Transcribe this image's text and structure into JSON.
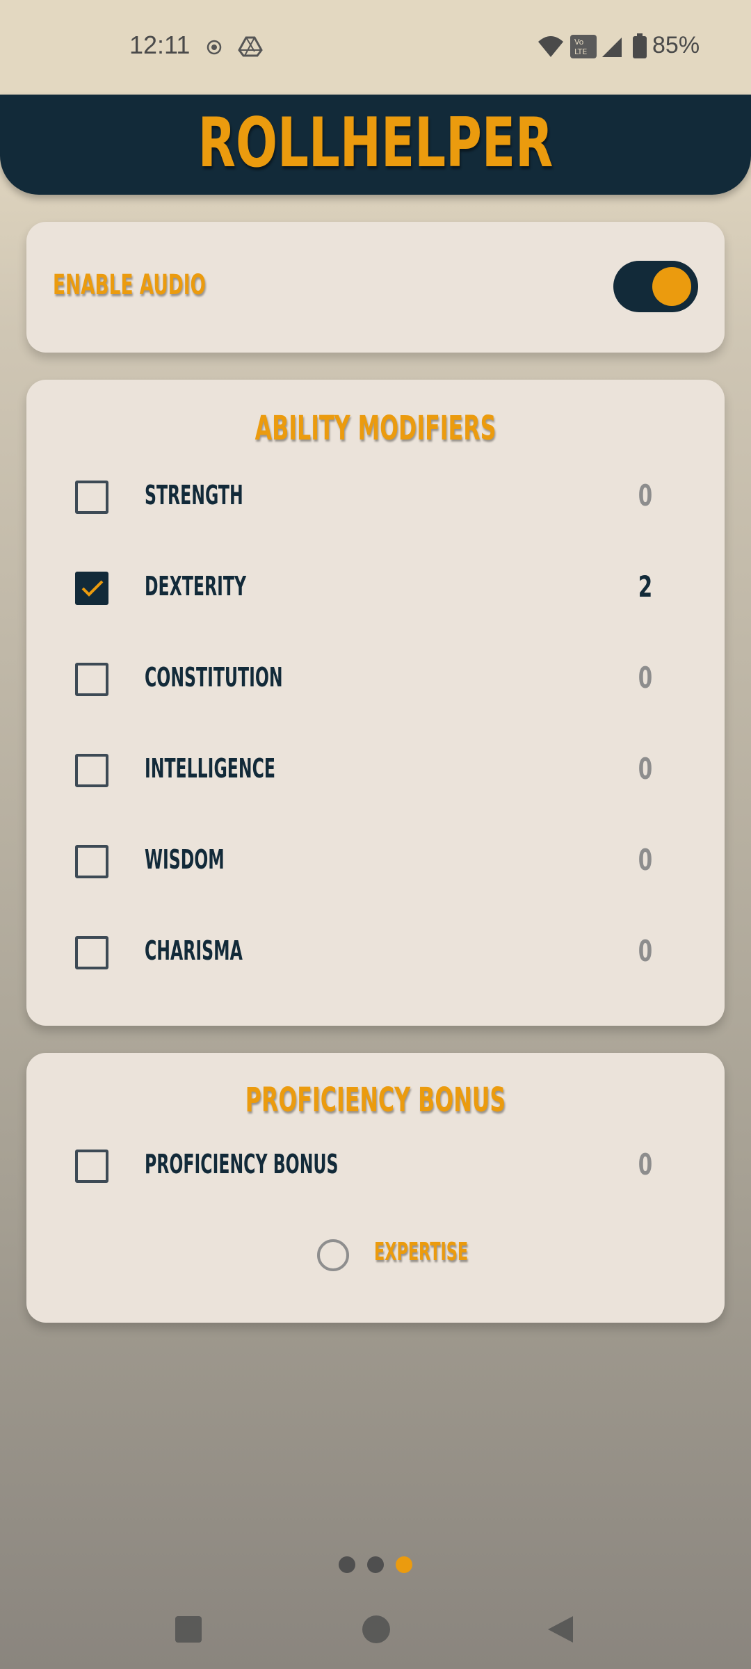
{
  "status_bar": {
    "time": "12:11",
    "battery": "85%",
    "icons": [
      "screen-record-icon",
      "drive-icon",
      "wifi-icon",
      "volte-icon",
      "signal-icon",
      "battery-icon"
    ]
  },
  "header": {
    "title": "ROLLHELPER"
  },
  "audio": {
    "label": "ENABLE AUDIO",
    "enabled": true
  },
  "abilities": {
    "title": "ABILITY MODIFIERS",
    "items": [
      {
        "label": "STRENGTH",
        "value": "0",
        "checked": false
      },
      {
        "label": "DEXTERITY",
        "value": "2",
        "checked": true
      },
      {
        "label": "CONSTITUTION",
        "value": "0",
        "checked": false
      },
      {
        "label": "INTELLIGENCE",
        "value": "0",
        "checked": false
      },
      {
        "label": "WISDOM",
        "value": "0",
        "checked": false
      },
      {
        "label": "CHARISMA",
        "value": "0",
        "checked": false
      }
    ]
  },
  "proficiency": {
    "title": "PROFICIENCY BONUS",
    "item": {
      "label": "PROFICIENCY BONUS",
      "value": "0",
      "checked": false
    },
    "expertise_label": "EXPERTISE",
    "expertise_selected": false
  },
  "page_indicator": {
    "count": 3,
    "active_index": 2
  },
  "colors": {
    "accent": "#eb9b0e",
    "navy": "#122a39",
    "card": "#ebe3da",
    "muted_value": "#8d8d8d"
  }
}
